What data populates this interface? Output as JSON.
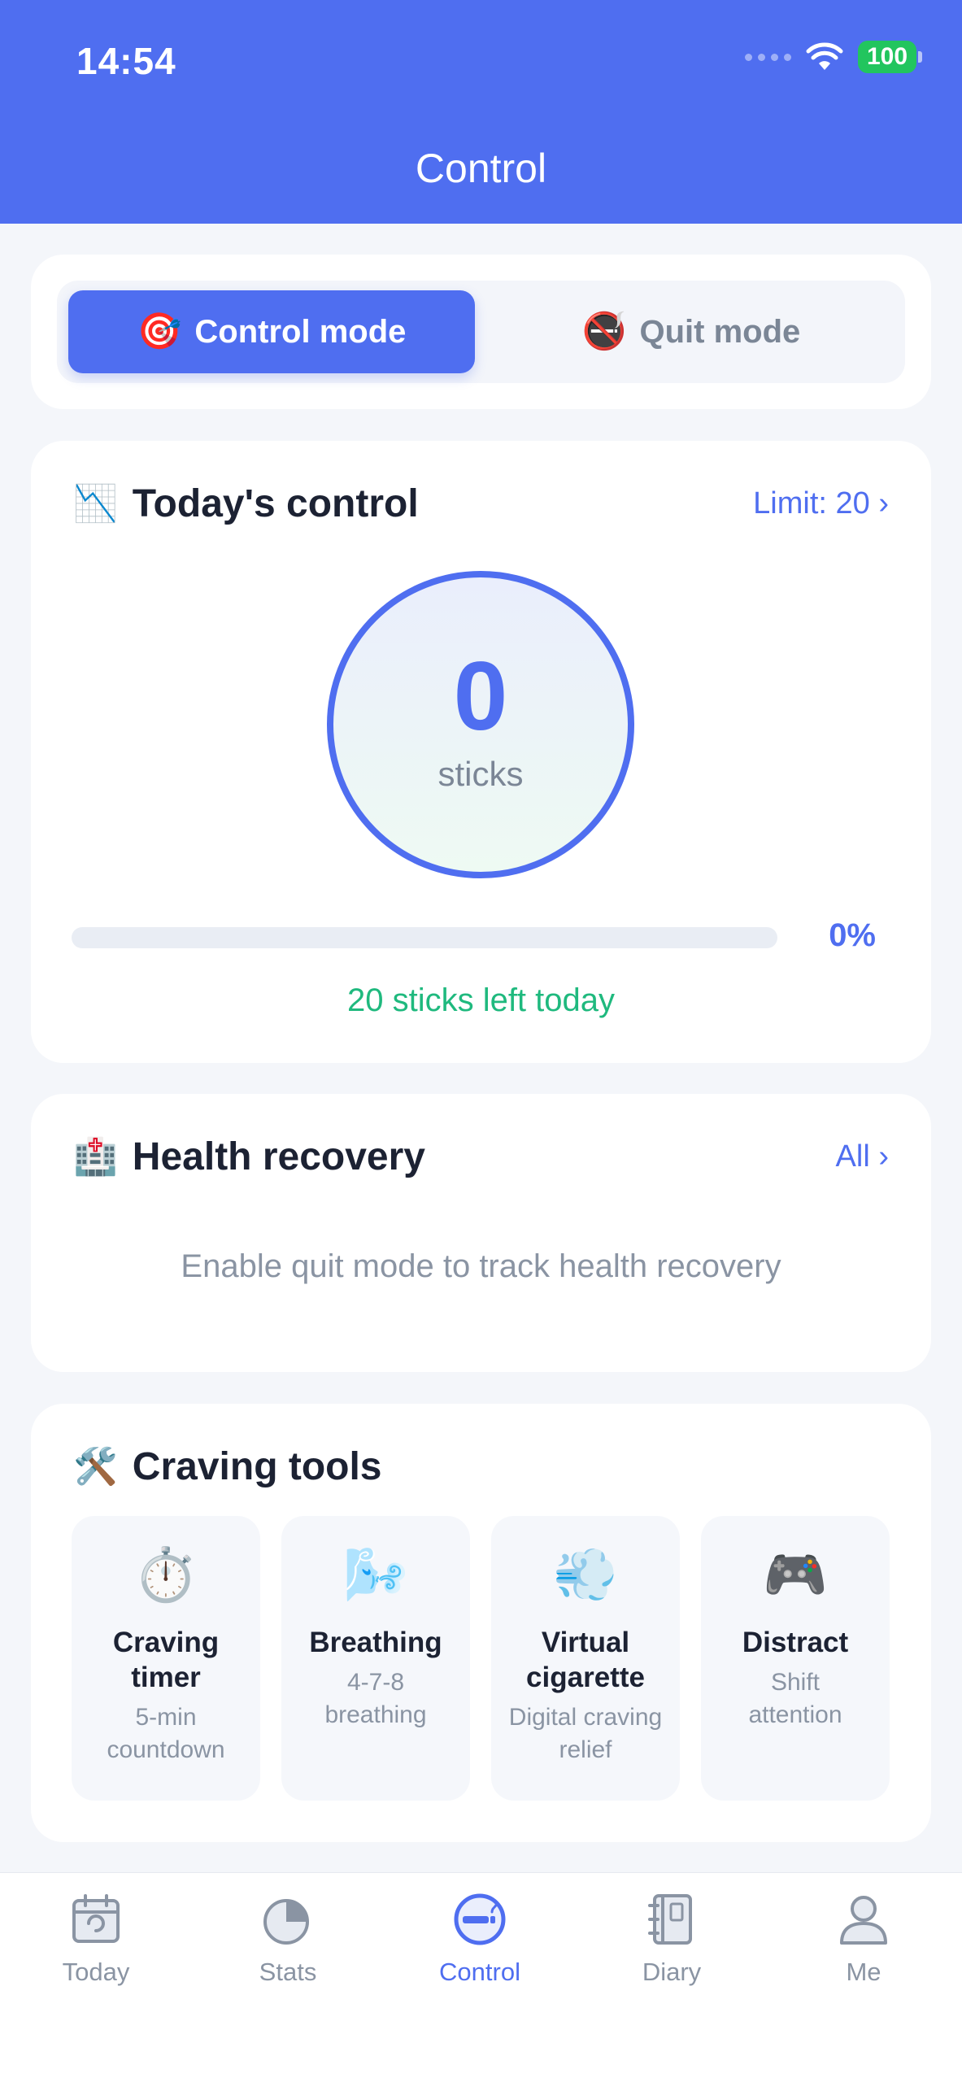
{
  "status": {
    "time": "14:54",
    "battery": "100"
  },
  "header": {
    "title": "Control"
  },
  "mode": {
    "control_label": "Control mode",
    "quit_label": "Quit mode"
  },
  "today": {
    "title": "Today's control",
    "limit_link": "Limit: 20 ›",
    "count": "0",
    "unit": "sticks",
    "progress_fraction": 0,
    "progress_label": "0%",
    "left_text": "20 sticks left today"
  },
  "health": {
    "title": "Health recovery",
    "all_link": "All ›",
    "message": "Enable quit mode to track health recovery"
  },
  "tools": {
    "title": "Craving tools",
    "items": [
      {
        "name": "Craving timer",
        "desc": "5-min countdown",
        "icon": "stopwatch-icon"
      },
      {
        "name": "Breathing",
        "desc": "4-7-8 breathing",
        "icon": "wind-face-icon"
      },
      {
        "name": "Virtual cigarette",
        "desc": "Digital craving relief",
        "icon": "smoke-puff-icon"
      },
      {
        "name": "Distract",
        "desc": "Shift attention",
        "icon": "gamepad-icon"
      }
    ]
  },
  "nav": {
    "items": [
      {
        "label": "Today",
        "active": false
      },
      {
        "label": "Stats",
        "active": false
      },
      {
        "label": "Control",
        "active": true
      },
      {
        "label": "Diary",
        "active": false
      },
      {
        "label": "Me",
        "active": false
      }
    ]
  },
  "colors": {
    "primary": "#4f6ef0",
    "success": "#1fb97e",
    "muted": "#8a94a3"
  }
}
